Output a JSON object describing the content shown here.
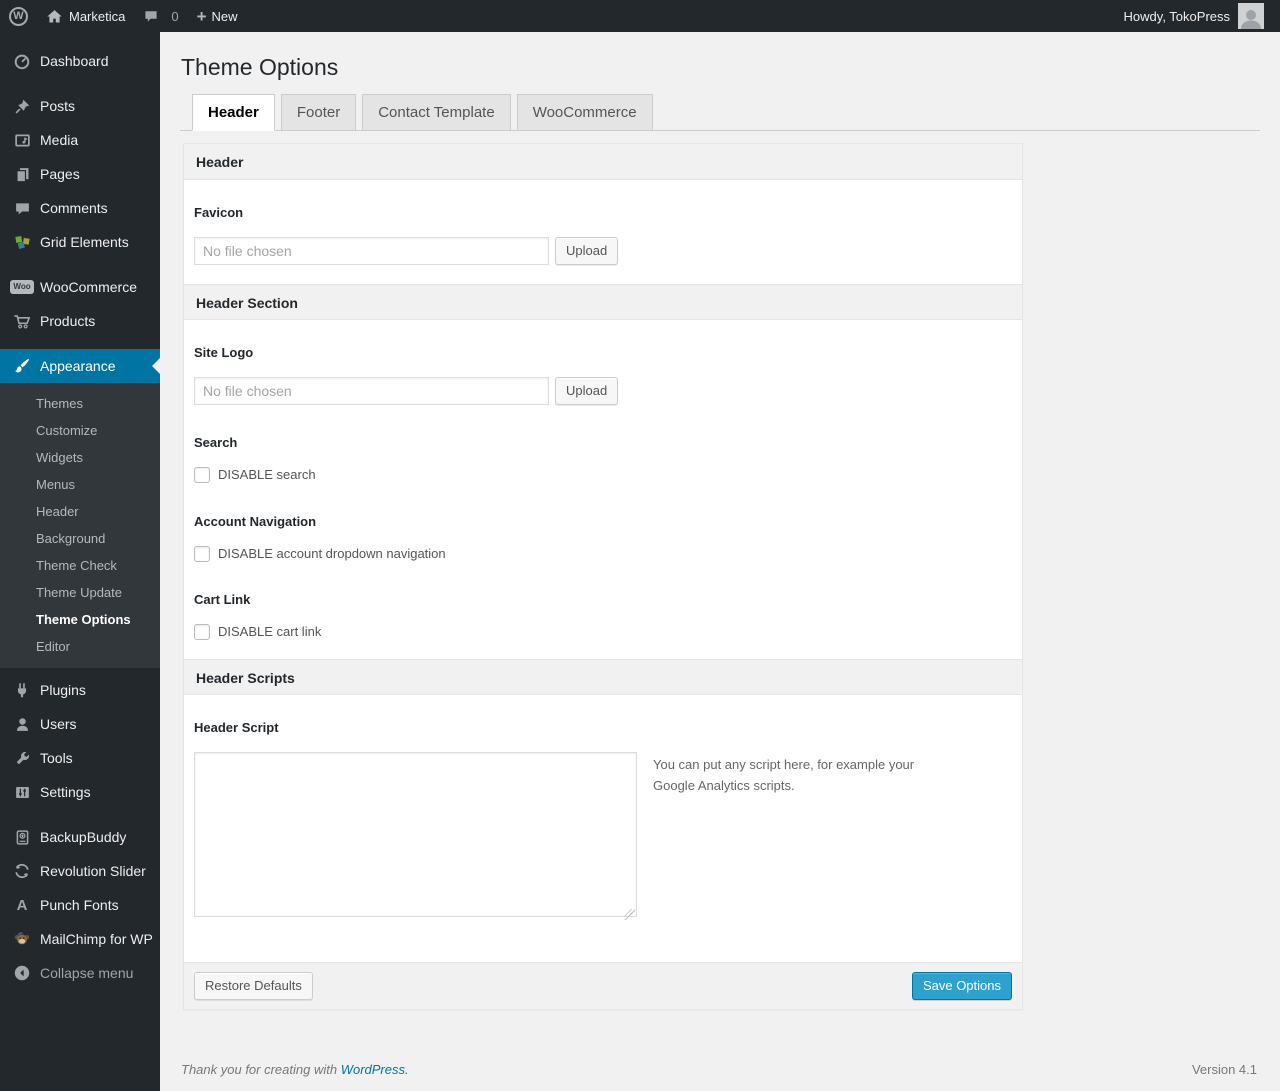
{
  "colors": {
    "admin_bar_bg": "#23282d",
    "submenu_bg": "#32373c",
    "accent_blue": "#0074a2",
    "primary_button_blue": "#2ea2cc",
    "page_bg": "#f1f1f1",
    "panel_bar_bg": "#f1f1f1"
  },
  "admin_bar": {
    "wp_logo": "W",
    "site_name": "Marketica",
    "comment_count": "0",
    "plus": "+",
    "new_label": "New",
    "howdy": "Howdy, TokoPress"
  },
  "sidebar": {
    "items": [
      {
        "label": "Dashboard",
        "icon": "dashboard-icon"
      },
      {
        "label": "Posts",
        "icon": "pin-icon"
      },
      {
        "label": "Media",
        "icon": "media-icon"
      },
      {
        "label": "Pages",
        "icon": "pages-icon"
      },
      {
        "label": "Comments",
        "icon": "comment-icon"
      },
      {
        "label": "Grid Elements",
        "icon": "grid-elements-icon"
      },
      {
        "label": "WooCommerce",
        "icon": "woocommerce-icon",
        "badge": "Woo"
      },
      {
        "label": "Products",
        "icon": "cart-icon"
      },
      {
        "label": "Appearance",
        "icon": "paintbrush-icon"
      },
      {
        "label": "Plugins",
        "icon": "plug-icon"
      },
      {
        "label": "Users",
        "icon": "user-icon"
      },
      {
        "label": "Tools",
        "icon": "wrench-icon"
      },
      {
        "label": "Settings",
        "icon": "sliders-icon"
      },
      {
        "label": "BackupBuddy",
        "icon": "backup-icon"
      },
      {
        "label": "Revolution Slider",
        "icon": "refresh-icon"
      },
      {
        "label": "Punch Fonts",
        "icon": "letter-a-icon",
        "glyph": "A"
      },
      {
        "label": "MailChimp for WP",
        "icon": "monkey-icon"
      }
    ],
    "appearance_submenu": [
      {
        "label": "Themes"
      },
      {
        "label": "Customize"
      },
      {
        "label": "Widgets"
      },
      {
        "label": "Menus"
      },
      {
        "label": "Header"
      },
      {
        "label": "Background"
      },
      {
        "label": "Theme Check"
      },
      {
        "label": "Theme Update"
      },
      {
        "label": "Theme Options",
        "current": true
      },
      {
        "label": "Editor"
      }
    ],
    "collapse_label": "Collapse menu"
  },
  "main": {
    "title": "Theme Options",
    "tabs": [
      {
        "label": "Header",
        "active": true
      },
      {
        "label": "Footer",
        "active": false
      },
      {
        "label": "Contact Template",
        "active": false
      },
      {
        "label": "WooCommerce",
        "active": false
      }
    ],
    "panel": {
      "sections": [
        {
          "header": "Header",
          "fields": [
            {
              "type": "file",
              "label": "Favicon",
              "placeholder": "No file chosen",
              "button": "Upload"
            }
          ]
        },
        {
          "header": "Header Section",
          "fields": [
            {
              "type": "file",
              "label": "Site Logo",
              "placeholder": "No file chosen",
              "button": "Upload"
            },
            {
              "type": "checkbox",
              "label": "Search",
              "checkbox_label": "DISABLE search",
              "checked": false
            },
            {
              "type": "checkbox",
              "label": "Account Navigation",
              "checkbox_label": "DISABLE account dropdown navigation",
              "checked": false
            },
            {
              "type": "checkbox",
              "label": "Cart Link",
              "checkbox_label": "DISABLE cart link",
              "checked": false
            }
          ]
        },
        {
          "header": "Header Scripts",
          "fields": [
            {
              "type": "textarea",
              "label": "Header Script",
              "value": "",
              "help": "You can put any script here, for example your Google Analytics scripts."
            }
          ]
        }
      ],
      "footer": {
        "restore_label": "Restore Defaults",
        "save_label": "Save Options"
      }
    }
  },
  "footer": {
    "thanks_prefix": "Thank you for creating with ",
    "wordpress_link": "WordPress.",
    "version": "Version 4.1"
  }
}
